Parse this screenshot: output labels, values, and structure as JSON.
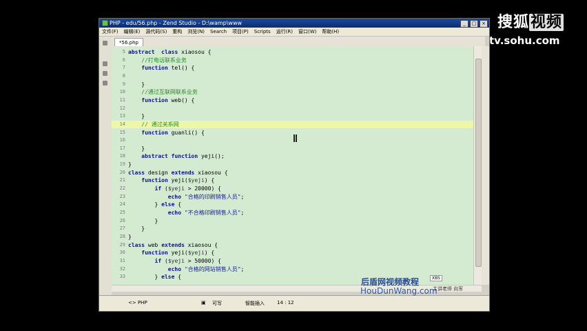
{
  "window": {
    "title": "PHP - edu/56.php - Zend Studio - D:\\wamp\\www"
  },
  "watermark": {
    "sohu_logo_text": "搜狐",
    "sohu_logo_box": "视频",
    "sohu_url": "tv.sohu.com"
  },
  "menu": [
    "文件(F)",
    "编辑(E)",
    "源代码(S)",
    "重构",
    "浏览(N)",
    "Search",
    "项目(P)",
    "Scripts",
    "运行(R)",
    "窗口(W)",
    "帮助(H)"
  ],
  "editor": {
    "tab_label": "*56.php",
    "lines": [
      {
        "n": "5",
        "code": [
          [
            "kw",
            "abstract"
          ],
          [
            "",
            "  "
          ],
          [
            "kw",
            "class"
          ],
          [
            "",
            " xiaosou {"
          ]
        ]
      },
      {
        "n": "6",
        "code": [
          [
            "",
            "    "
          ],
          [
            "cm",
            "//打电话联系业务"
          ]
        ]
      },
      {
        "n": "7",
        "code": [
          [
            "",
            "    "
          ],
          [
            "kw",
            "function"
          ],
          [
            "",
            " tel() {"
          ]
        ]
      },
      {
        "n": "8",
        "code": [
          [
            "",
            ""
          ]
        ]
      },
      {
        "n": "9",
        "code": [
          [
            "",
            "    }"
          ]
        ]
      },
      {
        "n": "10",
        "code": [
          [
            "",
            "    "
          ],
          [
            "cm",
            "//通过互联网联系业务"
          ]
        ]
      },
      {
        "n": "11",
        "code": [
          [
            "",
            "    "
          ],
          [
            "kw",
            "function"
          ],
          [
            "",
            " web() {"
          ]
        ]
      },
      {
        "n": "12",
        "code": [
          [
            "",
            ""
          ]
        ]
      },
      {
        "n": "13",
        "code": [
          [
            "",
            "    }"
          ]
        ]
      },
      {
        "n": "14",
        "code": [
          [
            "",
            "    "
          ],
          [
            "cm",
            "// 通过关系网"
          ]
        ],
        "highlight": true
      },
      {
        "n": "15",
        "code": [
          [
            "",
            "    "
          ],
          [
            "kw",
            "function"
          ],
          [
            "",
            " guanli() {"
          ]
        ]
      },
      {
        "n": "16",
        "code": [
          [
            "",
            ""
          ]
        ]
      },
      {
        "n": "17",
        "code": [
          [
            "",
            "    }"
          ]
        ]
      },
      {
        "n": "18",
        "code": [
          [
            "",
            "    "
          ],
          [
            "kw",
            "abstract"
          ],
          [
            "",
            " "
          ],
          [
            "kw",
            "function"
          ],
          [
            "",
            " yeji();"
          ]
        ]
      },
      {
        "n": "19",
        "code": [
          [
            "",
            "}"
          ]
        ]
      },
      {
        "n": "20",
        "code": [
          [
            "kw",
            "class"
          ],
          [
            "",
            " design "
          ],
          [
            "kw",
            "extends"
          ],
          [
            "",
            " xiaosou {"
          ]
        ]
      },
      {
        "n": "21",
        "code": [
          [
            "",
            "    "
          ],
          [
            "kw",
            "function"
          ],
          [
            "",
            " yeji("
          ],
          [
            "vr",
            "$yeji"
          ],
          [
            "",
            ") {"
          ]
        ]
      },
      {
        "n": "22",
        "code": [
          [
            "",
            "        "
          ],
          [
            "kw",
            "if"
          ],
          [
            "",
            " ("
          ],
          [
            "vr",
            "$yeji"
          ],
          [
            "",
            " > 20000) {"
          ]
        ]
      },
      {
        "n": "23",
        "code": [
          [
            "",
            "            "
          ],
          [
            "kw",
            "echo"
          ],
          [
            "",
            " "
          ],
          [
            "st",
            "\"合格的印刷销售人员\""
          ],
          [
            "",
            ";"
          ]
        ]
      },
      {
        "n": "24",
        "code": [
          [
            "",
            "        } "
          ],
          [
            "kw",
            "else"
          ],
          [
            "",
            " {"
          ]
        ]
      },
      {
        "n": "25",
        "code": [
          [
            "",
            "            "
          ],
          [
            "kw",
            "echo"
          ],
          [
            "",
            " "
          ],
          [
            "st",
            "\"不合格印刷销售人员\""
          ],
          [
            "",
            ";"
          ]
        ]
      },
      {
        "n": "26",
        "code": [
          [
            "",
            "        }"
          ]
        ]
      },
      {
        "n": "27",
        "code": [
          [
            "",
            "    }"
          ]
        ]
      },
      {
        "n": "28",
        "code": [
          [
            "",
            "}"
          ]
        ]
      },
      {
        "n": "29",
        "code": [
          [
            "kw",
            "class"
          ],
          [
            "",
            " web "
          ],
          [
            "kw",
            "extends"
          ],
          [
            "",
            " xiaosou {"
          ]
        ]
      },
      {
        "n": "30",
        "code": [
          [
            "",
            "    "
          ],
          [
            "kw",
            "function"
          ],
          [
            "",
            " yeji("
          ],
          [
            "vr",
            "$yeji"
          ],
          [
            "",
            ") {"
          ]
        ]
      },
      {
        "n": "31",
        "code": [
          [
            "",
            "        "
          ],
          [
            "kw",
            "if"
          ],
          [
            "",
            " ("
          ],
          [
            "vr",
            "$yeji"
          ],
          [
            "",
            " > 50000) {"
          ]
        ]
      },
      {
        "n": "32",
        "code": [
          [
            "",
            "            "
          ],
          [
            "kw",
            "echo"
          ],
          [
            "",
            " "
          ],
          [
            "st",
            "\"合格的网站销售人员\""
          ],
          [
            "",
            ";"
          ]
        ]
      },
      {
        "n": "33",
        "code": [
          [
            "",
            "        } "
          ],
          [
            "kw",
            "else"
          ],
          [
            "",
            " {"
          ]
        ]
      }
    ]
  },
  "status": {
    "breadcrumb": "<> PHP",
    "writable": "可写",
    "insert_mode": "智能插入",
    "position": "14 : 12"
  },
  "brand": {
    "name": "后盾网视频教程",
    "url": "HouDunWang.com",
    "teacher": "主讲老师  向军",
    "tag": "XBS"
  }
}
